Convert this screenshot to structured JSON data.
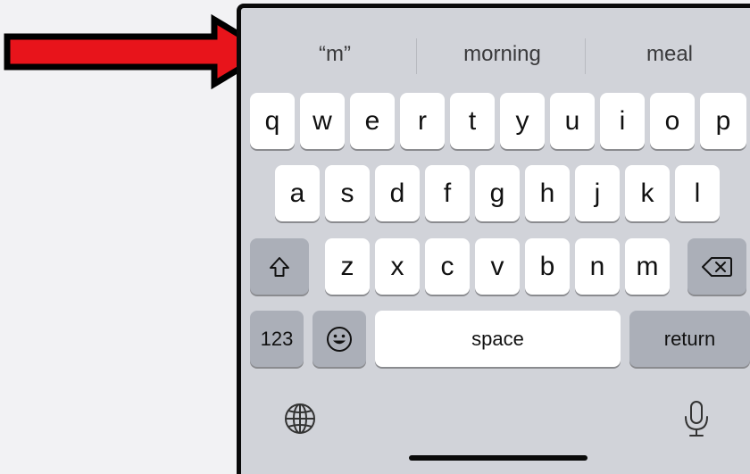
{
  "suggestions": [
    {
      "label": "“m”"
    },
    {
      "label": "morning"
    },
    {
      "label": "meal"
    }
  ],
  "keyboard": {
    "row1": [
      "q",
      "w",
      "e",
      "r",
      "t",
      "y",
      "u",
      "i",
      "o",
      "p"
    ],
    "row2": [
      "a",
      "s",
      "d",
      "f",
      "g",
      "h",
      "j",
      "k",
      "l"
    ],
    "row3": [
      "z",
      "x",
      "c",
      "v",
      "b",
      "n",
      "m"
    ],
    "numbers_label": "123",
    "space_label": "space",
    "return_label": "return"
  },
  "icons": {
    "shift": "shift-icon",
    "delete": "backspace-icon",
    "emoji": "emoji-icon",
    "globe": "globe-icon",
    "mic": "microphone-icon",
    "annotation": "red-arrow-icon"
  },
  "colors": {
    "keyboard_bg": "#d1d3d9",
    "key_bg": "#ffffff",
    "special_key_bg": "#abafb8",
    "arrow": "#e8141b"
  }
}
